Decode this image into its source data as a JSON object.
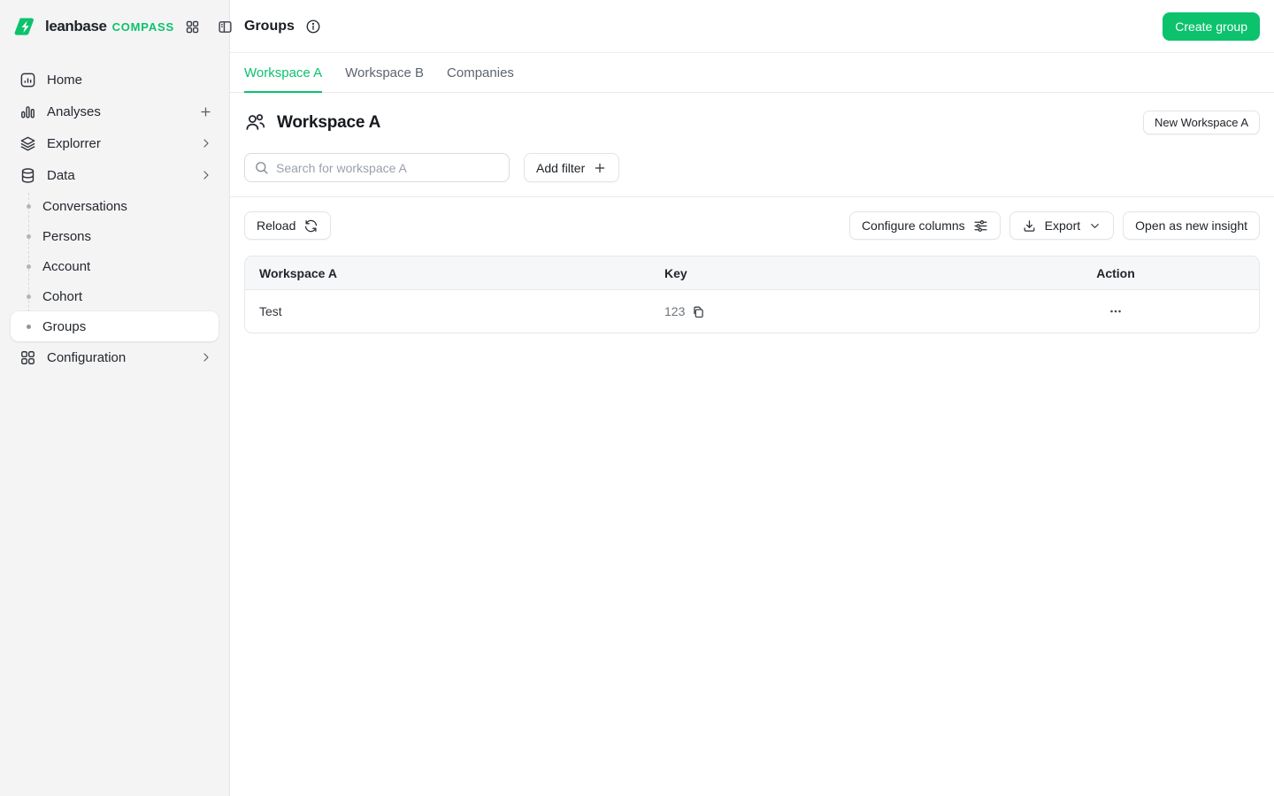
{
  "brand": {
    "name": "leanbase",
    "suffix": "COMPASS",
    "accent_color": "#0cc26d"
  },
  "sidebar": {
    "items": [
      {
        "label": "Home",
        "icon": "home-chart-icon"
      },
      {
        "label": "Analyses",
        "icon": "bar-chart-icon",
        "trailing_icon": "plus-icon"
      },
      {
        "label": "Explorrer",
        "icon": "layers-icon",
        "trailing_icon": "chevron-right-icon"
      },
      {
        "label": "Data",
        "icon": "database-icon",
        "trailing_icon": "chevron-right-icon"
      },
      {
        "label": "Configuration",
        "icon": "grid-icon",
        "trailing_icon": "chevron-right-icon"
      }
    ],
    "data_children": [
      {
        "label": "Conversations",
        "active": false
      },
      {
        "label": "Persons",
        "active": false
      },
      {
        "label": "Account",
        "active": false
      },
      {
        "label": "Cohort",
        "active": false
      },
      {
        "label": "Groups",
        "active": true
      }
    ]
  },
  "header": {
    "title": "Groups",
    "create_button_label": "Create group"
  },
  "tabs": [
    {
      "label": "Workspace A",
      "active": true
    },
    {
      "label": "Workspace B",
      "active": false
    },
    {
      "label": "Companies",
      "active": false
    }
  ],
  "section": {
    "title": "Workspace A",
    "new_button_label": "New Workspace A",
    "search_placeholder": "Search for workspace A",
    "add_filter_label": "Add filter"
  },
  "toolbar": {
    "reload_label": "Reload",
    "configure_columns_label": "Configure columns",
    "export_label": "Export",
    "open_insight_label": "Open as new insight"
  },
  "table": {
    "columns": [
      "Workspace A",
      "Key",
      "Action"
    ],
    "rows": [
      {
        "name": "Test",
        "key": "123"
      }
    ]
  },
  "icons": [
    "leanbase-logo-icon",
    "apps-grid-icon",
    "sidebar-toggle-icon",
    "home-chart-icon",
    "bar-chart-icon",
    "layers-icon",
    "database-icon",
    "grid-icon",
    "chevron-right-icon",
    "plus-icon",
    "info-icon",
    "users-icon",
    "search-icon",
    "refresh-icon",
    "sliders-icon",
    "download-icon",
    "chevron-down-icon",
    "copy-icon",
    "ellipsis-icon"
  ]
}
